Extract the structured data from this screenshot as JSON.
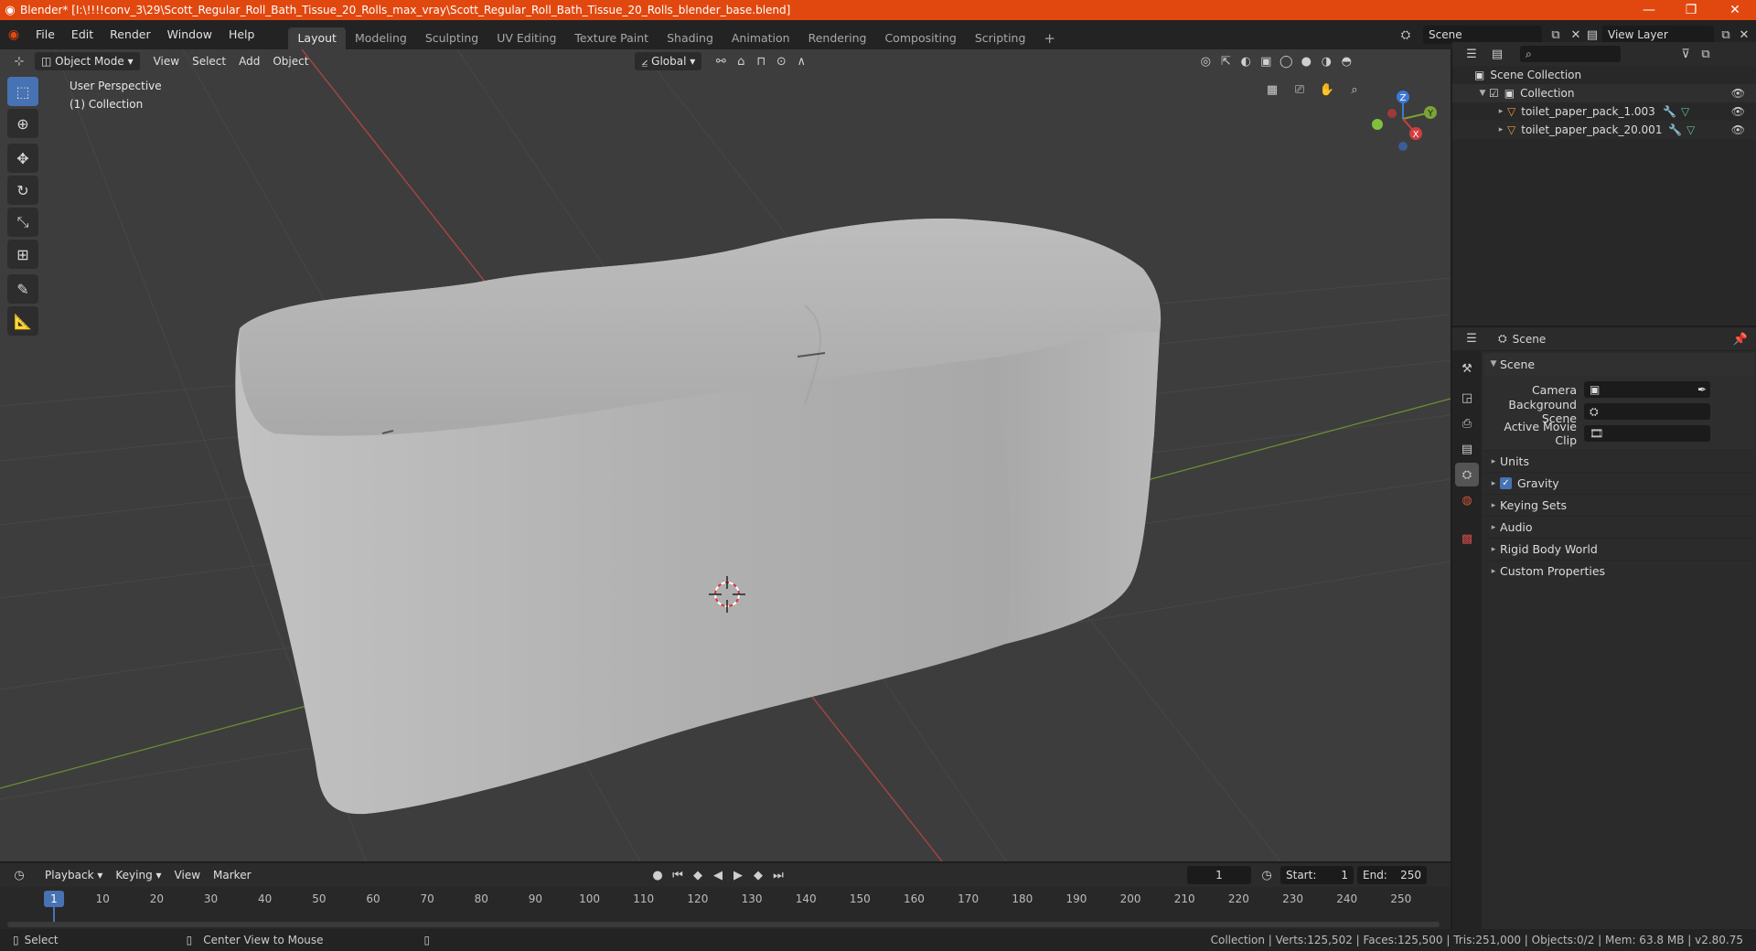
{
  "window": {
    "title": "Blender* [I:\\!!!!conv_3\\29\\Scott_Regular_Roll_Bath_Tissue_20_Rolls_max_vray\\Scott_Regular_Roll_Bath_Tissue_20_Rolls_blender_base.blend]",
    "minimize": "—",
    "maximize": "❐",
    "close": "✕"
  },
  "menu": {
    "items": [
      "File",
      "Edit",
      "Render",
      "Window",
      "Help"
    ],
    "workspaces": [
      "Layout",
      "Modeling",
      "Sculpting",
      "UV Editing",
      "Texture Paint",
      "Shading",
      "Animation",
      "Rendering",
      "Compositing",
      "Scripting"
    ],
    "active_workspace": "Layout",
    "add_workspace": "+",
    "scene_name": "Scene",
    "view_layer": "View Layer"
  },
  "viewport": {
    "mode": "Object Mode",
    "menus": [
      "View",
      "Select",
      "Add",
      "Object"
    ],
    "transform_orientation": "Global",
    "overlay_line1": "User Perspective",
    "overlay_line2": "(1) Collection",
    "gizmo": {
      "x": "X",
      "y": "Y",
      "z": "Z"
    },
    "colors": {
      "bg": "#3d3d3d",
      "x_axis": "#c94b4b",
      "y_axis": "#7aa33c",
      "object": "#b8b8b8",
      "active_tool": "#4772b3"
    }
  },
  "tools": [
    "select-box",
    "cursor",
    "move",
    "rotate",
    "scale",
    "transform",
    "annotate",
    "measure"
  ],
  "outliner": {
    "root": "Scene Collection",
    "collection": "Collection",
    "objects": [
      "toilet_paper_pack_1.003",
      "toilet_paper_pack_20.001"
    ]
  },
  "properties": {
    "header": "Scene",
    "panel": "Scene",
    "fields": [
      {
        "label": "Camera",
        "value": ""
      },
      {
        "label": "Background Scene",
        "value": ""
      },
      {
        "label": "Active Movie Clip",
        "value": ""
      }
    ],
    "sections": [
      "Units",
      "Gravity",
      "Keying Sets",
      "Audio",
      "Rigid Body World",
      "Custom Properties"
    ],
    "gravity_checked": true
  },
  "timeline": {
    "menus": [
      "Playback",
      "Keying",
      "View",
      "Marker"
    ],
    "current_frame": "1",
    "start_label": "Start:",
    "start": "1",
    "end_label": "End:",
    "end": "250",
    "ticks": [
      10,
      20,
      30,
      40,
      50,
      60,
      70,
      80,
      90,
      100,
      110,
      120,
      130,
      140,
      150,
      160,
      170,
      180,
      190,
      200,
      210,
      220,
      230,
      240,
      250
    ],
    "playhead_label": "1"
  },
  "status": {
    "left": "Select",
    "middle": "Center View to Mouse",
    "right": "Collection | Verts:125,502 | Faces:125,500 | Tris:251,000 | Objects:0/2 | Mem: 63.8 MB | v2.80.75"
  }
}
